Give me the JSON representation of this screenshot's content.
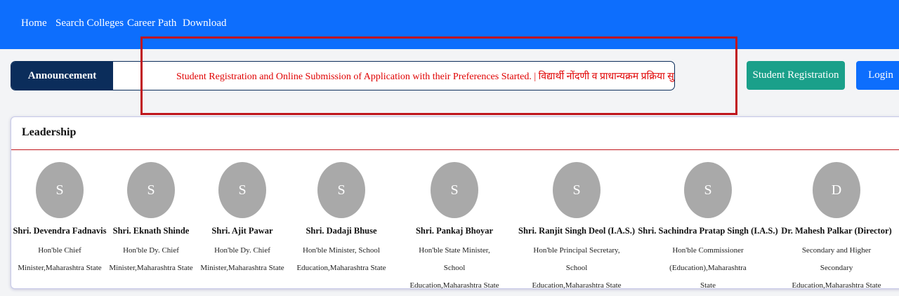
{
  "nav": {
    "items": [
      {
        "label": "Home"
      },
      {
        "label": "Search Colleges"
      },
      {
        "label": "Career Path"
      },
      {
        "label": "Download"
      }
    ]
  },
  "announcement": {
    "label": "Announcement",
    "text": "Student Registration and Online Submission of Application with their Preferences Started. | विद्यार्थी नोंदणी व प्राधान्यक्रम प्रक्रिया सुरु व"
  },
  "actions": {
    "register_label": "Student Registration",
    "login_label": "Login"
  },
  "leadership": {
    "title": "Leadership",
    "people": [
      {
        "initial": "S",
        "name": "Shri. Devendra Fadnavis",
        "role": "Hon'ble Chief Minister,Maharashtra State"
      },
      {
        "initial": "S",
        "name": "Shri. Eknath Shinde",
        "role": "Hon'ble Dy. Chief Minister,Maharashtra State"
      },
      {
        "initial": "S",
        "name": "Shri. Ajit Pawar",
        "role": "Hon'ble Dy. Chief Minister,Maharashtra State"
      },
      {
        "initial": "S",
        "name": "Shri. Dadaji Bhuse",
        "role": "Hon'ble Minister, School Education,Maharashtra State"
      },
      {
        "initial": "S",
        "name": "Shri. Pankaj Bhoyar",
        "role": "Hon'ble State Minister, School Education,Maharashtra State"
      },
      {
        "initial": "S",
        "name": "Shri. Ranjit Singh Deol (I.A.S.)",
        "role": "Hon'ble Principal Secretary, School Education,Maharashtra State"
      },
      {
        "initial": "S",
        "name": "Shri. Sachindra Pratap Singh (I.A.S.)",
        "role": "Hon'ble Commissioner (Education),Maharashtra State"
      },
      {
        "initial": "D",
        "name": "Dr. Mahesh Palkar (Director)",
        "role": "Secondary and Higher Secondary Education,Maharashtra State"
      }
    ]
  },
  "colors": {
    "navbar": "#0d6efd",
    "announcement_label_bg": "#0b2d5b",
    "announcement_text": "#e00000",
    "highlight_border": "#c0161d",
    "register_button": "#1aa08a",
    "login_button": "#0d6efd",
    "avatar_bg": "#a9a9a9"
  }
}
